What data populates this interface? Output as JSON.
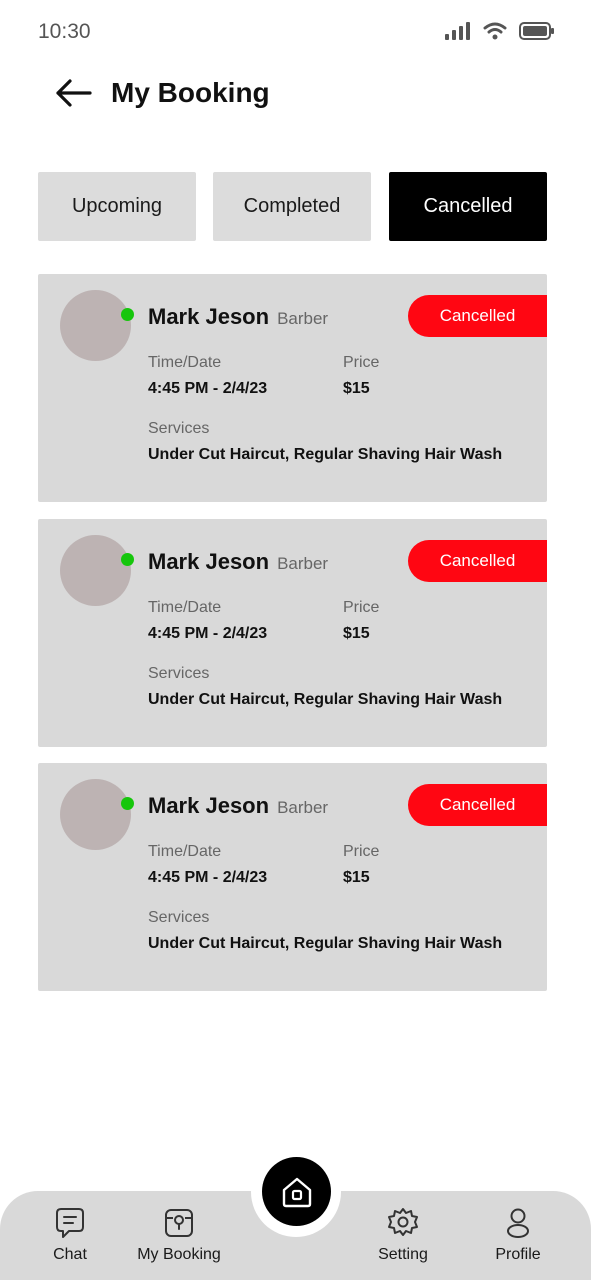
{
  "status_bar": {
    "time": "10:30"
  },
  "header": {
    "title": "My Booking"
  },
  "tabs": [
    {
      "label": "Upcoming",
      "active": false
    },
    {
      "label": "Completed",
      "active": false
    },
    {
      "label": "Cancelled",
      "active": true
    }
  ],
  "bookings": [
    {
      "name": "Mark Jeson",
      "role": "Barber",
      "status": "Cancelled",
      "time_label": "Time/Date",
      "time_value": "4:45 PM - 2/4/23",
      "price_label": "Price",
      "price_value": "$15",
      "services_label": "Services",
      "services_value": "Under Cut Haircut, Regular Shaving Hair Wash"
    },
    {
      "name": "Mark Jeson",
      "role": "Barber",
      "status": "Cancelled",
      "time_label": "Time/Date",
      "time_value": "4:45 PM - 2/4/23",
      "price_label": "Price",
      "price_value": "$15",
      "services_label": "Services",
      "services_value": "Under Cut Haircut, Regular Shaving Hair Wash"
    },
    {
      "name": "Mark Jeson",
      "role": "Barber",
      "status": "Cancelled",
      "time_label": "Time/Date",
      "time_value": "4:45 PM - 2/4/23",
      "price_label": "Price",
      "price_value": "$15",
      "services_label": "Services",
      "services_value": "Under Cut Haircut, Regular Shaving Hair Wash"
    }
  ],
  "bottom_nav": {
    "items": [
      {
        "label": "Chat",
        "icon": "chat-icon"
      },
      {
        "label": "My Booking",
        "icon": "booking-icon"
      },
      {
        "label": "Setting",
        "icon": "gear-icon"
      },
      {
        "label": "Profile",
        "icon": "profile-icon"
      }
    ],
    "home_icon": "home-icon"
  },
  "colors": {
    "accent": "#000000",
    "status_cancelled": "#ff0612",
    "online": "#16c60c",
    "card_bg": "#d9d9d9"
  }
}
